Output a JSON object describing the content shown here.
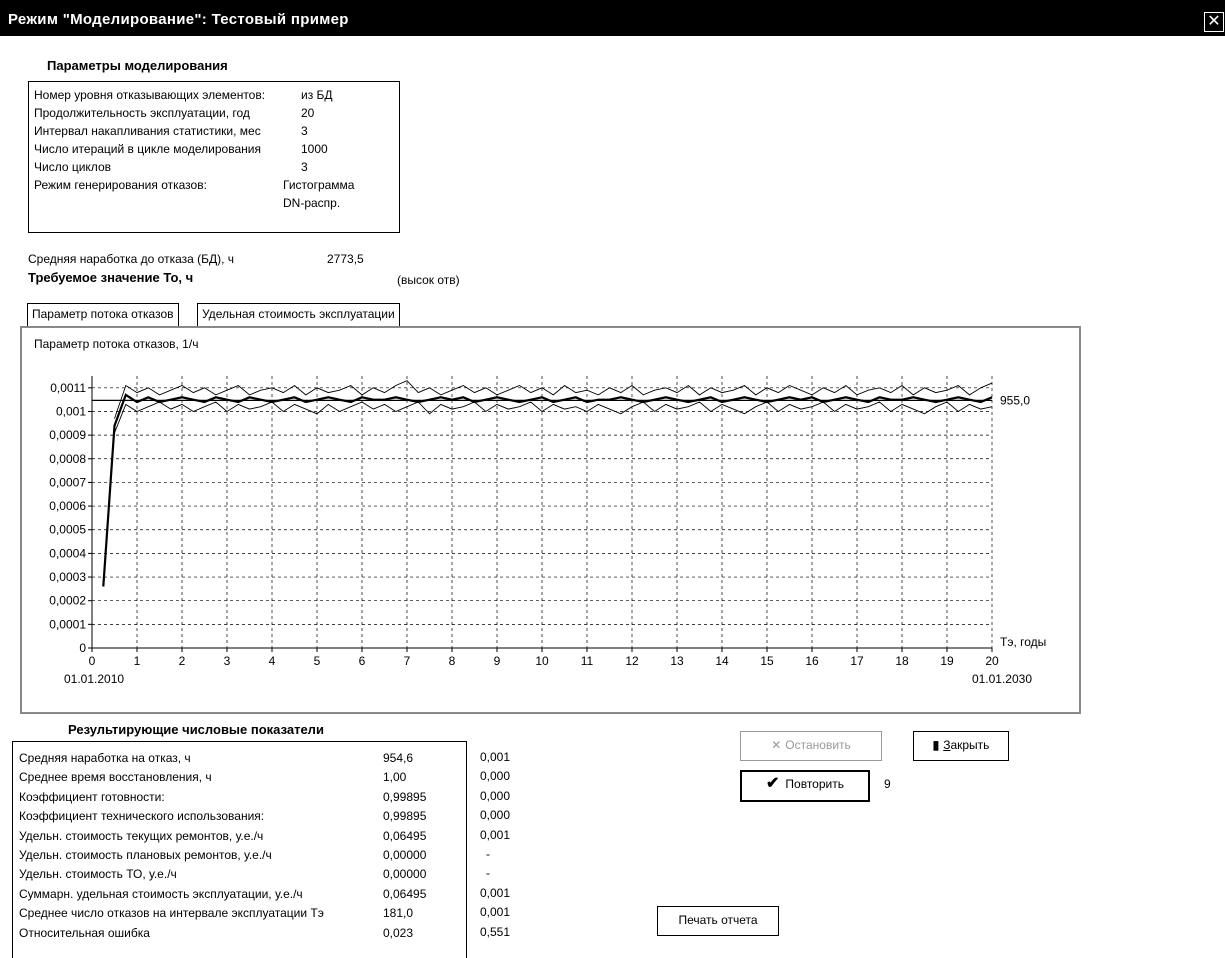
{
  "window": {
    "title": "Режим \"Моделирование\":  Тестовый пример"
  },
  "params": {
    "title": "Параметры моделирования",
    "rows": [
      {
        "label": "Номер уровня отказывающих элементов:",
        "value": "из БД"
      },
      {
        "label": "Продолжительность эксплуатации, год",
        "value": "20"
      },
      {
        "label": "Интервал накапливания статистики, мес",
        "value": "3"
      },
      {
        "label": "Число итераций в цикле моделирования",
        "value": "1000"
      },
      {
        "label": "Число циклов",
        "value": "3"
      },
      {
        "label": "Режим генерирования отказов:",
        "value": "Гистограмма"
      },
      {
        "label": "",
        "value": "DN-распр."
      }
    ]
  },
  "mtbf_db": {
    "label": "Средняя наработка до отказа (БД), ч",
    "value": "2773,5"
  },
  "required": {
    "label": "Требуемое значение То,  ч",
    "note": "(высок отв)"
  },
  "tabs": [
    {
      "label": "Параметр потока отказов",
      "active": true
    },
    {
      "label": "Удельная стоимость эксплуатации",
      "active": false
    }
  ],
  "chart_data": {
    "type": "line",
    "title": "Параметр потока отказов, 1/ч",
    "xlabel": "Тэ, годы",
    "x_ticks": [
      "0",
      "1",
      "2",
      "3",
      "4",
      "5",
      "6",
      "7",
      "8",
      "9",
      "10",
      "11",
      "12",
      "13",
      "14",
      "15",
      "16",
      "17",
      "18",
      "19",
      "20"
    ],
    "y_ticks": [
      "0",
      "0,0001",
      "0,0002",
      "0,0003",
      "0,0004",
      "0,0005",
      "0,0006",
      "0,0007",
      "0,0008",
      "0,0009",
      "0,001",
      "0,0011"
    ],
    "xlim": [
      0,
      20
    ],
    "ylim": [
      0,
      0.00115
    ],
    "start_date": "01.01.2010",
    "end_date": "01.01.2030",
    "reference_label": "955,0",
    "reference_value": 0.001047,
    "grid": true,
    "series": [
      {
        "role": "mean",
        "x": [
          0.25,
          0.5,
          0.75,
          1,
          1.25,
          1.5,
          1.75,
          2,
          2.25,
          2.5,
          2.75,
          3,
          3.25,
          3.5,
          3.75,
          4,
          4.25,
          4.5,
          4.75,
          5,
          5.25,
          5.5,
          5.75,
          6,
          6.25,
          6.5,
          6.75,
          7,
          7.25,
          7.5,
          7.75,
          8,
          8.25,
          8.5,
          8.75,
          9,
          9.25,
          9.5,
          9.75,
          10,
          10.25,
          10.5,
          10.75,
          11,
          11.25,
          11.5,
          11.75,
          12,
          12.25,
          12.5,
          12.75,
          13,
          13.25,
          13.5,
          13.75,
          14,
          14.25,
          14.5,
          14.75,
          15,
          15.25,
          15.5,
          15.75,
          16,
          16.25,
          16.5,
          16.75,
          17,
          17.25,
          17.5,
          17.75,
          18,
          18.25,
          18.5,
          18.75,
          19,
          19.25,
          19.5,
          19.75,
          20
        ],
        "y": [
          0.00026,
          0.00094,
          0.00107,
          0.00104,
          0.00106,
          0.00104,
          0.00105,
          0.00106,
          0.00105,
          0.00104,
          0.00106,
          0.00105,
          0.00104,
          0.00106,
          0.00105,
          0.00104,
          0.00105,
          0.00106,
          0.00104,
          0.00105,
          0.00106,
          0.00105,
          0.00104,
          0.00106,
          0.00105,
          0.00105,
          0.00106,
          0.00105,
          0.00104,
          0.00105,
          0.00106,
          0.00105,
          0.00106,
          0.00104,
          0.00105,
          0.00106,
          0.00105,
          0.00104,
          0.00105,
          0.00106,
          0.00104,
          0.00105,
          0.00106,
          0.00104,
          0.00105,
          0.00105,
          0.00106,
          0.00105,
          0.00104,
          0.00105,
          0.00106,
          0.00105,
          0.00104,
          0.00105,
          0.00106,
          0.00104,
          0.00105,
          0.00106,
          0.00105,
          0.00104,
          0.00105,
          0.00106,
          0.00105,
          0.00106,
          0.00104,
          0.00105,
          0.00106,
          0.00105,
          0.00104,
          0.00106,
          0.00105,
          0.00105,
          0.00106,
          0.00105,
          0.00104,
          0.00105,
          0.00106,
          0.00105,
          0.00104,
          0.00106
        ]
      },
      {
        "role": "upper",
        "x": [
          0.5,
          0.75,
          1,
          1.25,
          1.5,
          1.75,
          2,
          2.25,
          2.5,
          2.75,
          3,
          3.25,
          3.5,
          3.75,
          4,
          4.25,
          4.5,
          4.75,
          5,
          5.25,
          5.5,
          5.75,
          6,
          6.25,
          6.5,
          6.75,
          7,
          7.25,
          7.5,
          7.75,
          8,
          8.25,
          8.5,
          8.75,
          9,
          9.25,
          9.5,
          9.75,
          10,
          10.25,
          10.5,
          10.75,
          11,
          11.25,
          11.5,
          11.75,
          12,
          12.25,
          12.5,
          12.75,
          13,
          13.25,
          13.5,
          13.75,
          14,
          14.25,
          14.5,
          14.75,
          15,
          15.25,
          15.5,
          15.75,
          16,
          16.25,
          16.5,
          16.75,
          17,
          17.25,
          17.5,
          17.75,
          18,
          18.25,
          18.5,
          18.75,
          19,
          19.25,
          19.5,
          19.75,
          20
        ],
        "y": [
          0.00097,
          0.00111,
          0.00108,
          0.0011,
          0.00107,
          0.00109,
          0.00111,
          0.00108,
          0.0011,
          0.00107,
          0.00109,
          0.00111,
          0.00107,
          0.00109,
          0.0011,
          0.00108,
          0.00111,
          0.00107,
          0.0011,
          0.00108,
          0.00109,
          0.00111,
          0.00107,
          0.0011,
          0.00108,
          0.00111,
          0.00113,
          0.00108,
          0.0011,
          0.00107,
          0.00109,
          0.00111,
          0.00108,
          0.0011,
          0.00107,
          0.00109,
          0.00111,
          0.00108,
          0.0011,
          0.00107,
          0.00111,
          0.00108,
          0.00109,
          0.00107,
          0.0011,
          0.00108,
          0.00111,
          0.00107,
          0.00109,
          0.0011,
          0.00108,
          0.00111,
          0.00107,
          0.0011,
          0.00108,
          0.00109,
          0.00111,
          0.00107,
          0.0011,
          0.00108,
          0.00111,
          0.00109,
          0.00107,
          0.0011,
          0.00108,
          0.00111,
          0.00107,
          0.00109,
          0.0011,
          0.00108,
          0.00111,
          0.00107,
          0.0011,
          0.00108,
          0.00109,
          0.00111,
          0.00107,
          0.0011,
          0.00112
        ]
      },
      {
        "role": "lower",
        "x": [
          0.5,
          0.75,
          1,
          1.25,
          1.5,
          1.75,
          2,
          2.25,
          2.5,
          2.75,
          3,
          3.25,
          3.5,
          3.75,
          4,
          4.25,
          4.5,
          4.75,
          5,
          5.25,
          5.5,
          5.75,
          6,
          6.25,
          6.5,
          6.75,
          7,
          7.25,
          7.5,
          7.75,
          8,
          8.25,
          8.5,
          8.75,
          9,
          9.25,
          9.5,
          9.75,
          10,
          10.25,
          10.5,
          10.75,
          11,
          11.25,
          11.5,
          11.75,
          12,
          12.25,
          12.5,
          12.75,
          13,
          13.25,
          13.5,
          13.75,
          14,
          14.25,
          14.5,
          14.75,
          15,
          15.25,
          15.5,
          15.75,
          16,
          16.25,
          16.5,
          16.75,
          17,
          17.25,
          17.5,
          17.75,
          18,
          18.25,
          18.5,
          18.75,
          19,
          19.25,
          19.5,
          19.75,
          20
        ],
        "y": [
          0.00091,
          0.00103,
          0.001,
          0.00102,
          0.00104,
          0.00101,
          0.00103,
          0.001,
          0.00102,
          0.00104,
          0.001,
          0.00103,
          0.00101,
          0.00102,
          0.00104,
          0.001,
          0.00103,
          0.00101,
          0.00099,
          0.00103,
          0.001,
          0.00102,
          0.00104,
          0.00101,
          0.00103,
          0.001,
          0.00102,
          0.00104,
          0.00099,
          0.00103,
          0.00101,
          0.00102,
          0.00104,
          0.001,
          0.00103,
          0.00101,
          0.00102,
          0.00104,
          0.001,
          0.00103,
          0.00101,
          0.00102,
          0.001,
          0.00103,
          0.00101,
          0.00099,
          0.00102,
          0.00104,
          0.001,
          0.00103,
          0.00101,
          0.00102,
          0.00104,
          0.001,
          0.00103,
          0.00101,
          0.00099,
          0.00102,
          0.00104,
          0.001,
          0.00103,
          0.00101,
          0.00102,
          0.00104,
          0.001,
          0.00103,
          0.00101,
          0.00102,
          0.00104,
          0.001,
          0.00103,
          0.00101,
          0.00099,
          0.00102,
          0.00104,
          0.001,
          0.00103,
          0.00101,
          0.00102
        ]
      }
    ]
  },
  "results": {
    "title": "Результирующие числовые показатели",
    "rows": [
      {
        "label": "Средняя наработка на отказ, ч",
        "value": "954,6",
        "err": "0,001"
      },
      {
        "label": "Среднее время восстановления, ч",
        "value": "1,00",
        "err": "0,000"
      },
      {
        "label": "Коэффициент готовности:",
        "value": "0,99895",
        "err": "0,000"
      },
      {
        "label": "Коэффициент технического использования:",
        "value": "0,99895",
        "err": "0,000"
      },
      {
        "label": "Удельн. стоимость текущих ремонтов, у.е./ч",
        "value": "0,06495",
        "err": "0,001"
      },
      {
        "label": "Удельн. стоимость плановых ремонтов, у.е./ч",
        "value": "0,00000",
        "err": "-"
      },
      {
        "label": "Удельн. стоимость ТО, у.е./ч",
        "value": "0,00000",
        "err": "-"
      },
      {
        "label": "Суммарн. удельная стоимость эксплуатации, у.е./ч",
        "value": "0,06495",
        "err": "0,001"
      },
      {
        "label": "Среднее число отказов на интервале эксплуатации Тэ",
        "value": "181,0",
        "err": "0,001"
      },
      {
        "label": "Относительная ошибка",
        "value": "0,023",
        "err": "0,551"
      }
    ]
  },
  "buttons": {
    "stop": "Остановить",
    "close_prefix": "З",
    "close_rest": "акрыть",
    "repeat": "Повторить",
    "repeat_count": "9",
    "print": "Печать отчета"
  }
}
